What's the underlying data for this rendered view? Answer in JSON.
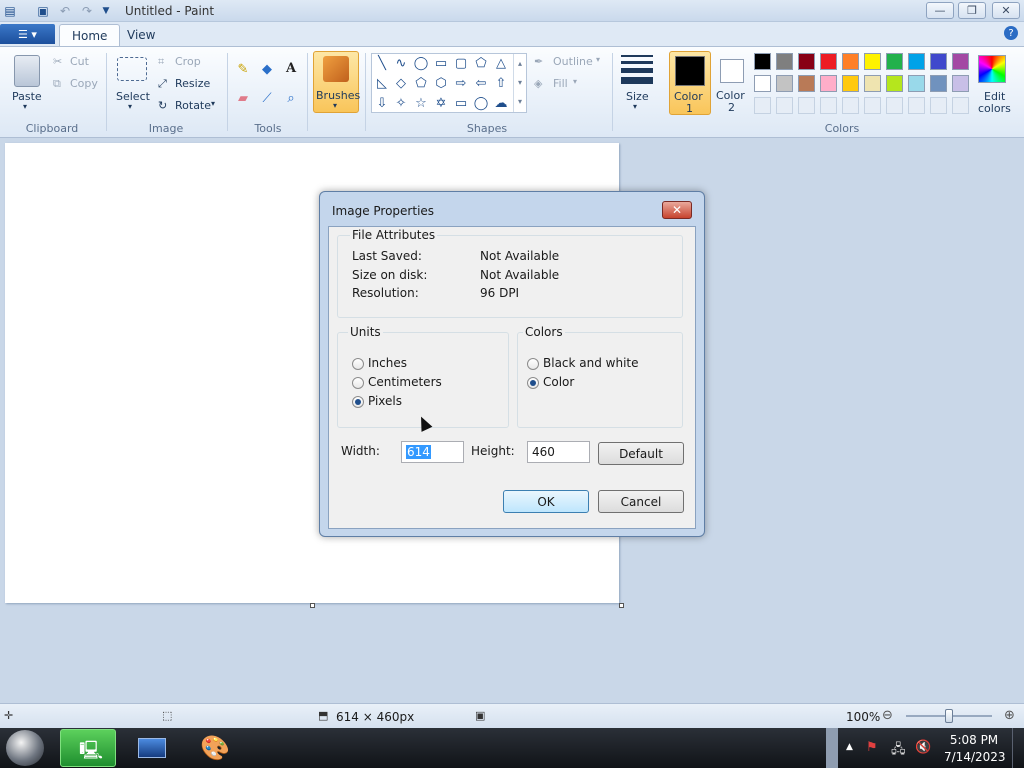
{
  "window": {
    "title": "Untitled - Paint",
    "minimize_glyph": "—",
    "restore_glyph": "❐",
    "close_glyph": "✕"
  },
  "tabs": {
    "home": "Home",
    "view": "View"
  },
  "ribbon": {
    "clipboard": {
      "label": "Clipboard",
      "paste": "Paste",
      "cut": "Cut",
      "copy": "Copy"
    },
    "image": {
      "label": "Image",
      "select": "Select",
      "crop": "Crop",
      "resize": "Resize",
      "rotate": "Rotate"
    },
    "tools": {
      "label": "Tools"
    },
    "brushes": "Brushes",
    "shapes": {
      "label": "Shapes",
      "outline": "Outline",
      "fill": "Fill"
    },
    "size": "Size",
    "color1": {
      "line1": "Color",
      "line2": "1"
    },
    "color2": {
      "line1": "Color",
      "line2": "2"
    },
    "colors_label": "Colors",
    "edit_colors": {
      "line1": "Edit",
      "line2": "colors"
    },
    "palette_row1": [
      "#000000",
      "#7f7f7f",
      "#880015",
      "#ed1c24",
      "#ff7f27",
      "#fff200",
      "#22b14c",
      "#00a2e8",
      "#3f48cc",
      "#a349a4"
    ],
    "palette_row2": [
      "#ffffff",
      "#c3c3c3",
      "#b97a57",
      "#ffaec9",
      "#ffc90e",
      "#efe4b0",
      "#b5e61d",
      "#99d9ea",
      "#7092be",
      "#c8bfe7"
    ]
  },
  "status": {
    "dimensions": "614 × 460px",
    "zoom": "100%"
  },
  "taskbar": {
    "time": "5:08 PM",
    "date": "7/14/2023"
  },
  "dialog": {
    "title": "Image Properties",
    "file_attributes": {
      "legend": "File Attributes",
      "last_saved_label": "Last Saved:",
      "last_saved_value": "Not Available",
      "size_label": "Size on disk:",
      "size_value": "Not Available",
      "resolution_label": "Resolution:",
      "resolution_value": "96 DPI"
    },
    "units": {
      "legend": "Units",
      "inches": "Inches",
      "centimeters": "Centimeters",
      "pixels": "Pixels",
      "selected": "pixels"
    },
    "colors": {
      "legend": "Colors",
      "bw": "Black and white",
      "color": "Color",
      "selected": "color"
    },
    "width_label": "Width:",
    "width_value": "614",
    "height_label": "Height:",
    "height_value": "460",
    "default_button": "Default",
    "ok_button": "OK",
    "cancel_button": "Cancel"
  }
}
